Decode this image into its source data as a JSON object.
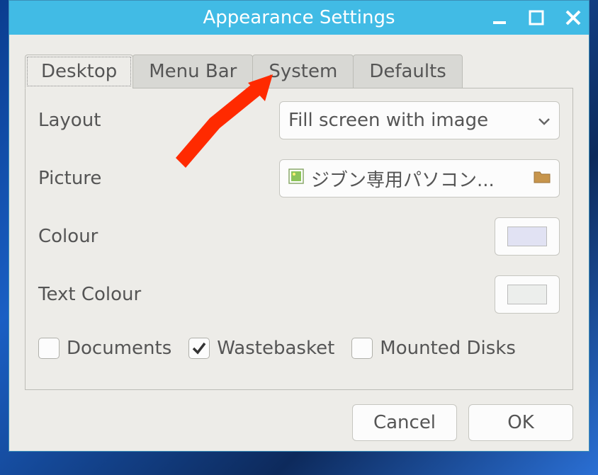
{
  "window": {
    "title": "Appearance Settings"
  },
  "tabs": {
    "desktop": "Desktop",
    "menubar": "Menu Bar",
    "system": "System",
    "defaults": "Defaults"
  },
  "labels": {
    "layout": "Layout",
    "picture": "Picture",
    "colour": "Colour",
    "text_colour": "Text Colour"
  },
  "layout": {
    "selected": "Fill screen with image"
  },
  "picture": {
    "filename": "ジブン専用パソコン..."
  },
  "colours": {
    "background": "#e1e2f3",
    "text": "#eceeec"
  },
  "checkboxes": {
    "documents": {
      "label": "Documents",
      "checked": false
    },
    "wastebasket": {
      "label": "Wastebasket",
      "checked": true
    },
    "mounted_disks": {
      "label": "Mounted Disks",
      "checked": false
    }
  },
  "buttons": {
    "cancel": "Cancel",
    "ok": "OK"
  }
}
